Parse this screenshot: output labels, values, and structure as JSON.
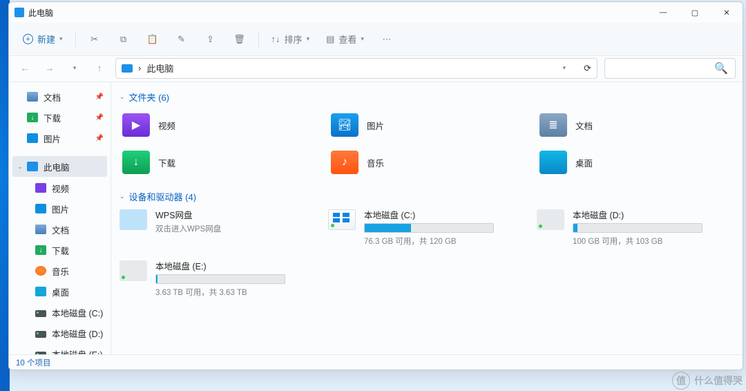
{
  "titlebar": {
    "title": "此电脑"
  },
  "toolbar": {
    "new_label": "新建",
    "sort_label": "排序",
    "view_label": "查看"
  },
  "breadcrumb": {
    "root": "›",
    "path": "此电脑"
  },
  "sidebar": {
    "quick": [
      {
        "label": "文档",
        "icon": "i-doc"
      },
      {
        "label": "下载",
        "icon": "i-dl"
      },
      {
        "label": "图片",
        "icon": "i-pic"
      }
    ],
    "thispc_label": "此电脑",
    "pc_children": [
      {
        "label": "视频",
        "icon": "i-vid"
      },
      {
        "label": "图片",
        "icon": "i-pic"
      },
      {
        "label": "文档",
        "icon": "i-doc"
      },
      {
        "label": "下载",
        "icon": "i-dl"
      },
      {
        "label": "音乐",
        "icon": "i-mus"
      },
      {
        "label": "桌面",
        "icon": "i-desk"
      },
      {
        "label": "本地磁盘 (C:)",
        "icon": "i-hdd"
      },
      {
        "label": "本地磁盘 (D:)",
        "icon": "i-hdd"
      },
      {
        "label": "本地磁盘 (E:)",
        "icon": "i-hdd"
      }
    ]
  },
  "sections": {
    "folders_header": "文件夹 (6)",
    "drives_header": "设备和驱动器 (4)"
  },
  "folders": [
    {
      "label": "视频",
      "cls": "fi-vid",
      "glyph": "▶"
    },
    {
      "label": "图片",
      "cls": "fi-pic",
      "glyph": "🏞"
    },
    {
      "label": "文档",
      "cls": "fi-doc",
      "glyph": "≣"
    },
    {
      "label": "下载",
      "cls": "fi-dl",
      "glyph": "↓"
    },
    {
      "label": "音乐",
      "cls": "fi-mus",
      "glyph": "♪"
    },
    {
      "label": "桌面",
      "cls": "fi-desk",
      "glyph": ""
    }
  ],
  "drives": [
    {
      "name": "WPS网盘",
      "sub": "双击进入WPS网盘",
      "icon": "cloud",
      "fill": 0
    },
    {
      "name": "本地磁盘 (C:)",
      "sub": "76.3 GB 可用，共 120 GB",
      "icon": "win",
      "fill": 36
    },
    {
      "name": "本地磁盘 (D:)",
      "sub": "100 GB 可用，共 103 GB",
      "icon": "plain",
      "fill": 3
    },
    {
      "name": "本地磁盘 (E:)",
      "sub": "3.63 TB 可用，共 3.63 TB",
      "icon": "plain",
      "fill": 1
    }
  ],
  "status": {
    "text": "10 个项目"
  },
  "watermark": {
    "text": "什么值得哭",
    "glyph": "值"
  }
}
